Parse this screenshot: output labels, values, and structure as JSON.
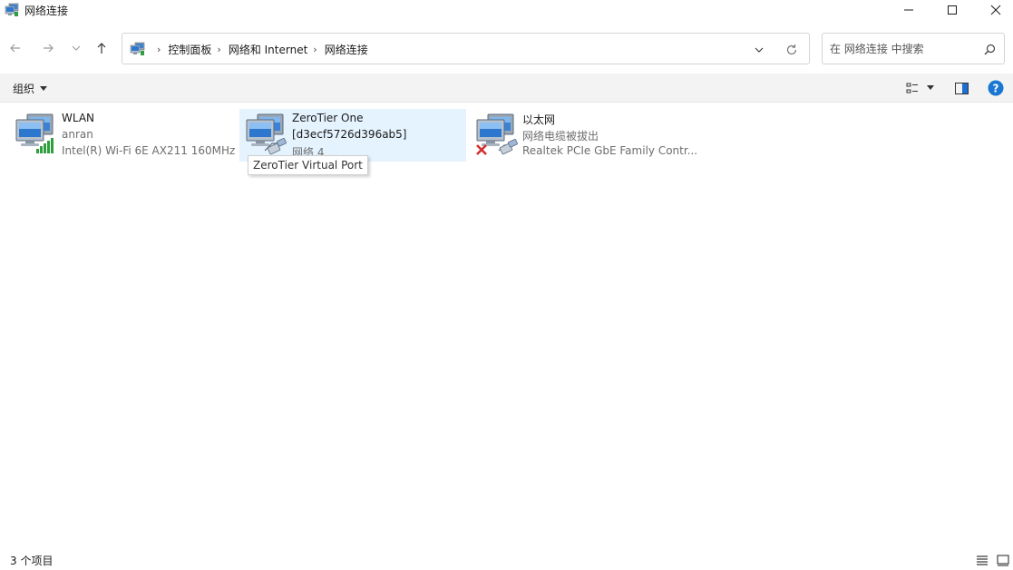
{
  "window": {
    "title": "网络连接"
  },
  "address": {
    "breadcrumbs": [
      "控制面板",
      "网络和 Internet",
      "网络连接"
    ]
  },
  "search": {
    "placeholder": "在 网络连接 中搜索"
  },
  "commandbar": {
    "organize_label": "组织"
  },
  "items": [
    {
      "name": "WLAN",
      "line2": "anran",
      "line3": "Intel(R) Wi-Fi 6E AX211 160MHz",
      "status_icon": "wifi-signal-icon"
    },
    {
      "name": "ZeroTier One",
      "line2": "[d3ecf5726d396ab5]",
      "line3": "网络 4",
      "status_icon": "network-cable-icon",
      "selected": true
    },
    {
      "name": "以太网",
      "line2": "网络电缆被拔出",
      "line3": "Realtek PCIe GbE Family Contr...",
      "status_icon": "disconnected-x-icon"
    }
  ],
  "tooltip": {
    "text": "ZeroTier Virtual Port"
  },
  "status": {
    "count": "3 个项目"
  },
  "colors": {
    "selection": "#e5f3ff",
    "commandbar": "#f3f3f3",
    "help": "#1976d2",
    "error": "#d32f2f"
  }
}
